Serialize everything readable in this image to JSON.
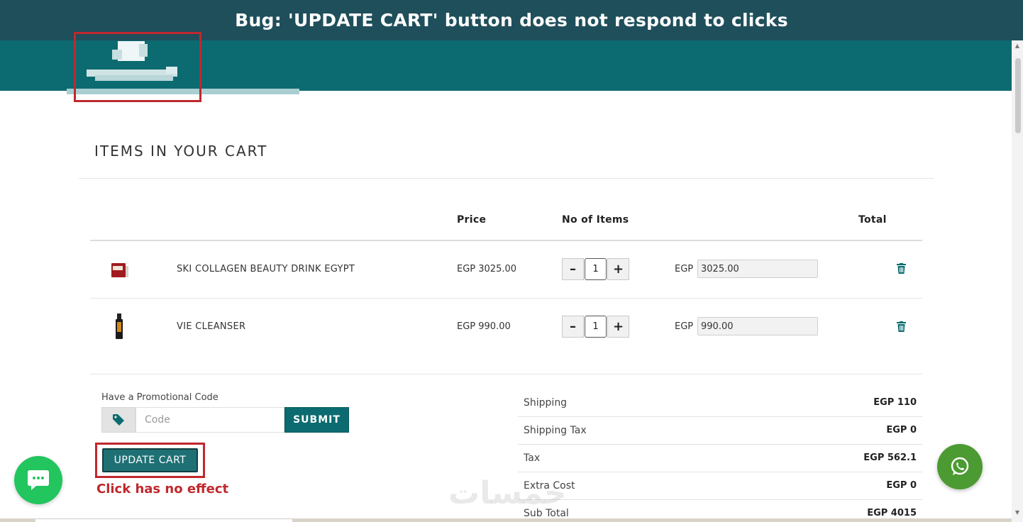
{
  "banner": {
    "text": "Bug: 'UPDATE CART' button does not respond to clicks"
  },
  "cart": {
    "title": "ITEMS IN YOUR CART",
    "columns": {
      "price": "Price",
      "qty": "No of Items",
      "total": "Total"
    },
    "items": [
      {
        "name": "SKI COLLAGEN BEAUTY DRINK EGYPT",
        "price": "EGP 3025.00",
        "qty": "1",
        "currency": "EGP",
        "total": "3025.00",
        "icon": "product-box-image"
      },
      {
        "name": "VIE CLEANSER",
        "price": "EGP 990.00",
        "qty": "1",
        "currency": "EGP",
        "total": "990.00",
        "icon": "product-bottle-image"
      }
    ],
    "qty_minus": "–",
    "qty_plus": "+"
  },
  "promo": {
    "label": "Have a Promotional Code",
    "placeholder": "Code",
    "submit": "SUBMIT"
  },
  "update_cart": {
    "label": "UPDATE CART",
    "annotation": "Click has no effect"
  },
  "summary": [
    {
      "label": "Shipping",
      "value": "EGP 110"
    },
    {
      "label": "Shipping Tax",
      "value": "EGP 0"
    },
    {
      "label": "Tax",
      "value": "EGP 562.1"
    },
    {
      "label": "Extra Cost",
      "value": "EGP 0"
    },
    {
      "label": "Sub Total",
      "value": "EGP 4015"
    }
  ],
  "watermark": "خمسات",
  "colors": {
    "brand": "#0b6b70",
    "banner": "#1f4f5b",
    "annotation": "#c0282d",
    "whatsapp": "#4c9a32",
    "chat": "#22c55e"
  }
}
